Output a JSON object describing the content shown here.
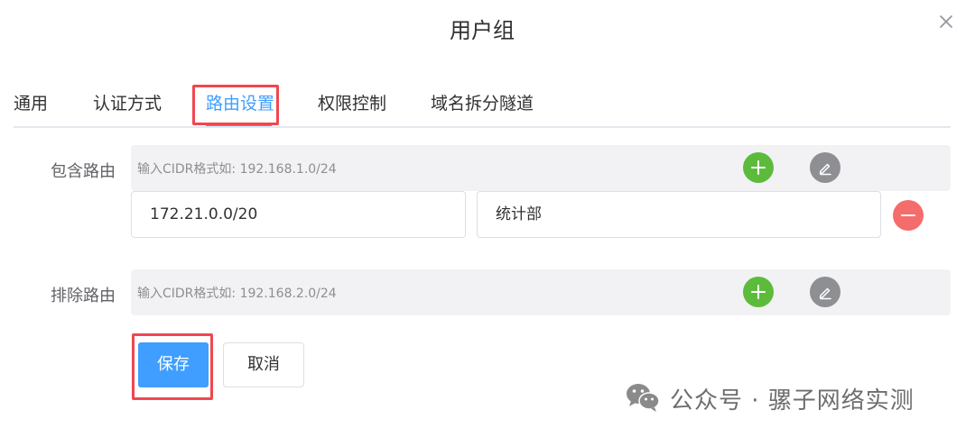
{
  "dialog": {
    "title": "用户组"
  },
  "tabs": [
    {
      "label": "通用",
      "active": false
    },
    {
      "label": "认证方式",
      "active": false
    },
    {
      "label": "路由设置",
      "active": true
    },
    {
      "label": "权限控制",
      "active": false
    },
    {
      "label": "域名拆分隧道",
      "active": false
    }
  ],
  "include_routes": {
    "label": "包含路由",
    "placeholder": "输入CIDR格式如: 192.168.1.0/24",
    "entries": [
      {
        "cidr": "172.21.0.0/20",
        "remark": "统计部"
      }
    ]
  },
  "exclude_routes": {
    "label": "排除路由",
    "placeholder": "输入CIDR格式如: 192.168.2.0/24"
  },
  "actions": {
    "save_label": "保存",
    "cancel_label": "取消"
  },
  "watermark": {
    "text": "公众号 · 骡子网络实测"
  },
  "colors": {
    "accent": "#409eff",
    "add": "#5dbb3c",
    "edit": "#8e8f93",
    "remove": "#f56c6c",
    "highlight": "#f0474f"
  },
  "icons": {
    "close": "close-icon",
    "add": "plus-icon",
    "edit": "pencil-icon",
    "remove": "minus-icon",
    "wechat": "wechat-icon"
  }
}
